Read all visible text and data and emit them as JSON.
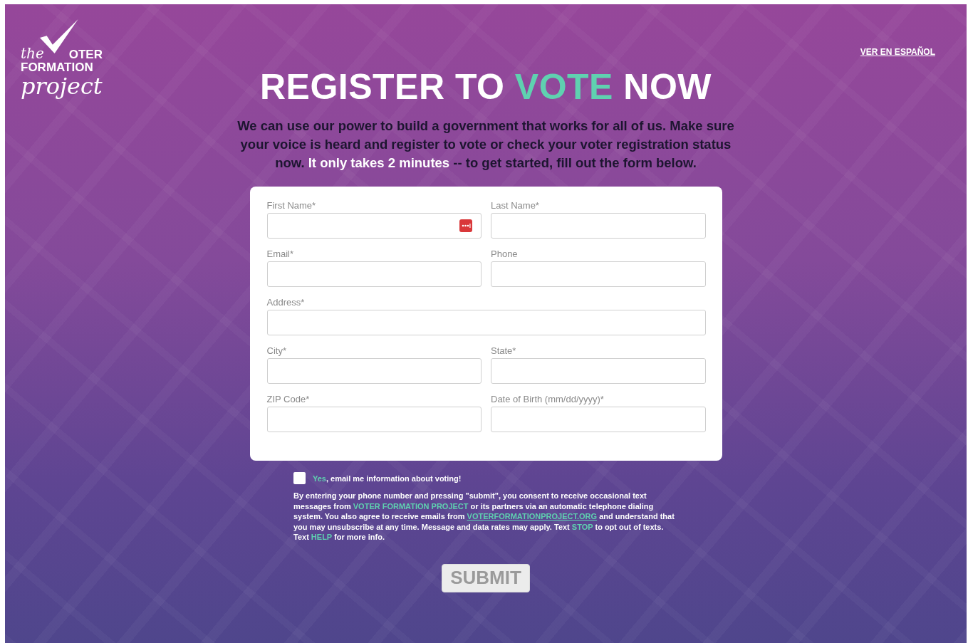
{
  "logo": {
    "prefix": "the",
    "word": "OTER",
    "line2": "FORMATION",
    "line3": "project"
  },
  "language_link": "VER EN ESPAÑOL",
  "headline": [
    {
      "text": "REGISTER TO ",
      "accent": false
    },
    {
      "text": "VOTE",
      "accent": true
    },
    {
      "text": " NOW",
      "accent": false
    }
  ],
  "intro": [
    {
      "text": "We can use our power to build a government that works for all of us. Make sure your voice is heard and register to vote or check your voter registration status now. ",
      "accent": false
    },
    {
      "text": "It only takes 2 minutes",
      "accent": true
    },
    {
      "text": " -- to get started, fill out the form below.",
      "accent": false
    }
  ],
  "form": {
    "fields": [
      {
        "label": "First Name*",
        "wide": false,
        "autofill_icon": true
      },
      {
        "label": "Last Name*",
        "wide": false,
        "autofill_icon": false
      },
      {
        "label": "Email*",
        "wide": false,
        "autofill_icon": false
      },
      {
        "label": "Phone",
        "wide": false,
        "autofill_icon": false
      },
      {
        "label": "Address*",
        "wide": true,
        "autofill_icon": false
      },
      {
        "label": "City*",
        "wide": false,
        "autofill_icon": false
      },
      {
        "label": "State*",
        "wide": false,
        "autofill_icon": false
      },
      {
        "label": "ZIP Code*",
        "wide": false,
        "autofill_icon": false
      },
      {
        "label": "Date of Birth (mm/dd/yyyy)*",
        "wide": false,
        "autofill_icon": false
      }
    ]
  },
  "email_opt_in": {
    "checked": false,
    "label": [
      {
        "text": "Yes",
        "kind": "accent"
      },
      {
        "text": ", email me information about voting!",
        "kind": "plain"
      }
    ]
  },
  "consent": [
    {
      "text": "By entering your phone number and pressing \"submit\", you consent to receive occasional text messages from ",
      "kind": "plain"
    },
    {
      "text": "VOTER FORMATION PROJECT",
      "kind": "accent"
    },
    {
      "text": " or its partners via an automatic telephone dialing system. You also agree to receive emails from ",
      "kind": "plain"
    },
    {
      "text": "VOTERFORMATIONPROJECT.ORG",
      "kind": "link"
    },
    {
      "text": " and understand that you may unsubscribe at any time. Message and data rates may apply. Text ",
      "kind": "plain"
    },
    {
      "text": "STOP",
      "kind": "accent"
    },
    {
      "text": " to opt out of texts. Text ",
      "kind": "plain"
    },
    {
      "text": "HELP",
      "kind": "accent"
    },
    {
      "text": " for more info.",
      "kind": "plain"
    }
  ],
  "submit": {
    "label": "SUBMIT",
    "disabled": true
  }
}
